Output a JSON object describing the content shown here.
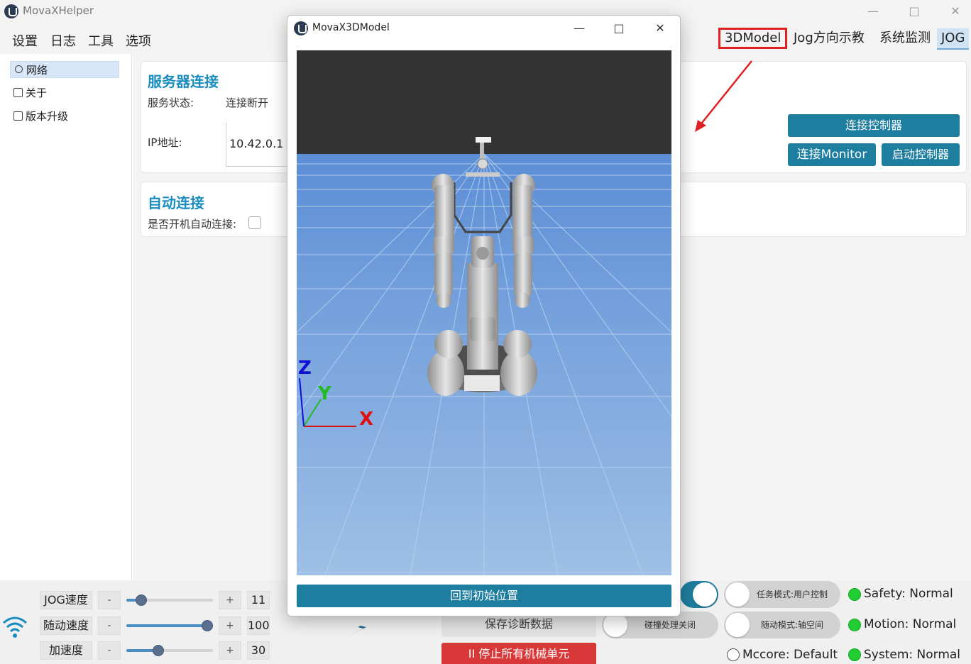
{
  "app": {
    "title": "MovaXHelper"
  },
  "menu": {
    "items": [
      "设置",
      "日志",
      "工具",
      "选项"
    ]
  },
  "right_tabs": [
    "3DModel",
    "Jog方向示教",
    "系统监测",
    "JOG"
  ],
  "nav": {
    "items": [
      "网络",
      "关于",
      "版本升级"
    ]
  },
  "server": {
    "title": "服务器连接",
    "status_label": "服务状态:",
    "status_value": "连接断开",
    "ip_label": "IP地址:",
    "ip_value": "10.42.0.1",
    "connect_controller": "连接控制器",
    "connect_monitor": "连接Monitor",
    "start_controller": "启动控制器"
  },
  "auto": {
    "title": "自动连接",
    "boot_label": "是否开机自动连接:"
  },
  "speeds": [
    {
      "label": "JOG速度",
      "minus": "-",
      "plus": "+",
      "value": "11",
      "level": 0.11
    },
    {
      "label": "随动速度",
      "minus": "-",
      "plus": "+",
      "value": "100",
      "level": 1.0
    },
    {
      "label": "加速度",
      "minus": "-",
      "plus": "+",
      "value": "30",
      "level": 0.3
    }
  ],
  "bottom": {
    "save_diag": "保存诊断数据",
    "stop_all": "II 停止所有机械单元",
    "task_mode": "任务模式:用户控制",
    "collision": "碰撞处理关闭",
    "follow_mode": "随动模式:轴空间"
  },
  "status": {
    "safety": "Safety: Normal",
    "motion": "Motion: Normal",
    "mccore": "Mccore: Default",
    "system": "System: Normal"
  },
  "dialog": {
    "title": "MovaX3DModel",
    "reset_button": "回到初始位置",
    "axis_x": "X",
    "axis_y": "Y",
    "axis_z": "Z"
  },
  "colors": {
    "accent": "#1e7ea0",
    "title_blue": "#1a8dc0",
    "stop_red": "#d93838",
    "status_green": "#22cc33",
    "highlight_red": "#e02020"
  }
}
